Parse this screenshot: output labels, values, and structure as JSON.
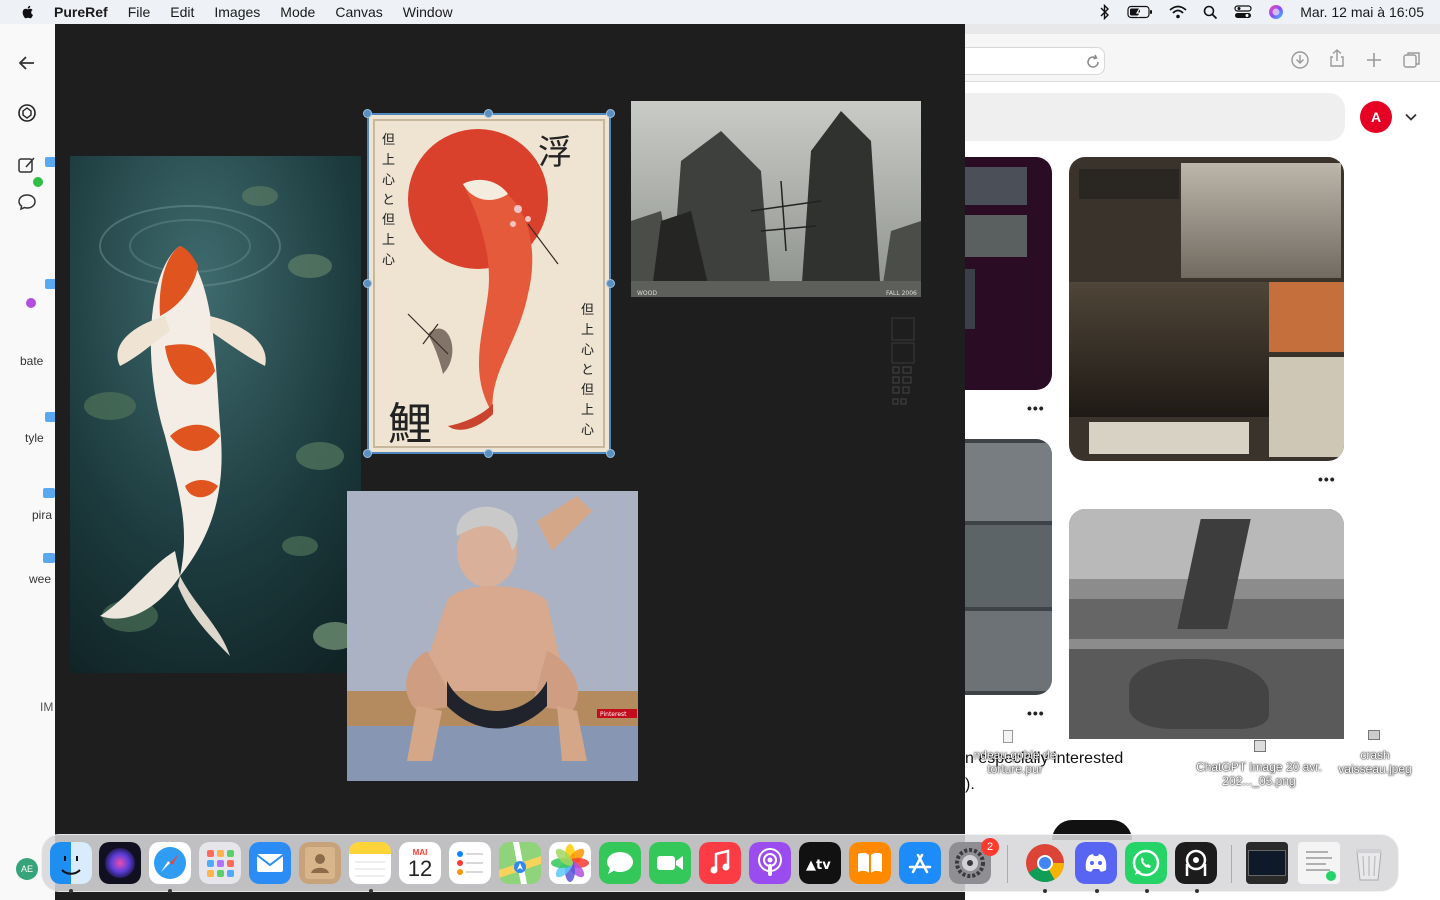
{
  "menubar": {
    "app_name": "PureRef",
    "items": [
      "File",
      "Edit",
      "Images",
      "Mode",
      "Canvas",
      "Window"
    ],
    "clock": "Mar. 12 mai à  16:05"
  },
  "chat_sidebar": {
    "labels": [
      "bate",
      "tyle",
      "pira",
      "wee",
      "IM"
    ],
    "account_initials": "AE"
  },
  "browser": {
    "avatar_initial": "A",
    "more_label": "•••"
  },
  "desktop": {
    "file_1": "ndeau.gobie de torture.pur",
    "file_2": "ChatGPT Image 20 avr. 202..._05.png",
    "file_3": "crash vaisseau.jpeg",
    "chat_fragment": "n especially interested",
    "chat_fragment_2": ")."
  },
  "pureref": {
    "watermark_1": "WOOD",
    "watermark_2": "FALL 2006",
    "pinterest_badge": "Pinterest",
    "selected_image": "koi-print"
  },
  "dock": {
    "calendar_month": "MAI",
    "calendar_day": "12",
    "settings_badge": "2",
    "apps": [
      "Finder",
      "Siri",
      "Safari",
      "Launchpad",
      "Mail",
      "Contacts",
      "Notes",
      "Calendar",
      "Reminders",
      "Maps",
      "Photos",
      "Messages",
      "FaceTime",
      "Music",
      "Podcasts",
      "TV",
      "Books",
      "App Store",
      "System Settings",
      "Chrome",
      "Discord",
      "WhatsApp",
      "PureRef"
    ]
  },
  "colors": {
    "pureref_canvas": "#1e1e1e",
    "selection": "#4f86bb",
    "pinterest_red": "#e60023"
  }
}
